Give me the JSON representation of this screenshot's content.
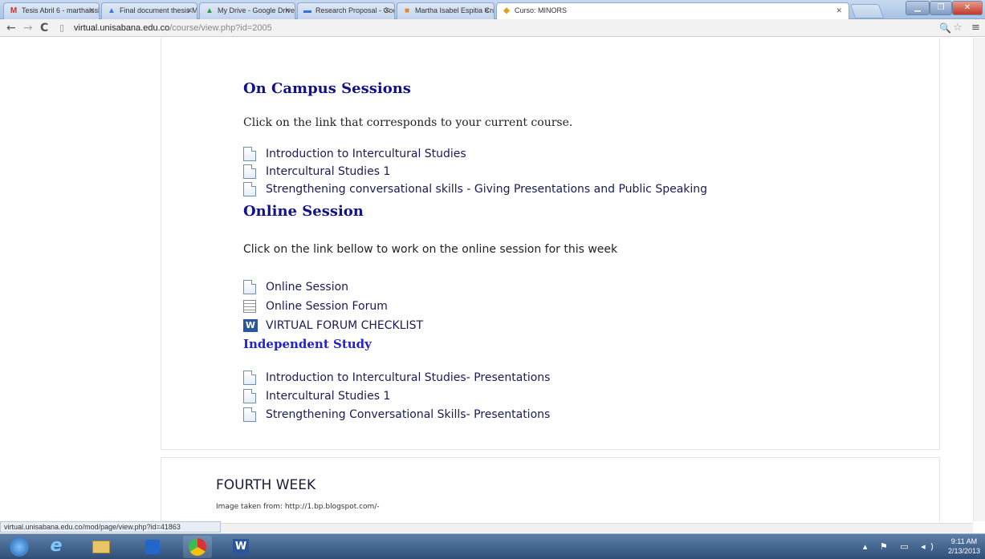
{
  "tabs": [
    {
      "label": "Tesis Abril 6 - marthaissb",
      "icon": "gmail-icon",
      "icon_glyph": "M",
      "icon_color": "#c8332b"
    },
    {
      "label": "Final document thesis Ma",
      "icon": "drive-doc-icon",
      "icon_glyph": "▲",
      "icon_color": "#3a7bd5"
    },
    {
      "label": "My Drive - Google Drive",
      "icon": "google-drive-icon",
      "icon_glyph": "▲",
      "icon_color": "#2e9c4a"
    },
    {
      "label": "Research Proposal - Goog",
      "icon": "google-slides-icon",
      "icon_glyph": "▬",
      "icon_color": "#3a6fd8"
    },
    {
      "label": "Martha Isabel Espitia Cruz",
      "icon": "office-icon",
      "icon_glyph": "■",
      "icon_color": "#e08a1e"
    },
    {
      "label": "Curso: MINORS",
      "icon": "moodle-icon",
      "icon_glyph": "◆",
      "icon_color": "#e0a020"
    }
  ],
  "address": {
    "domain": "virtual.unisabana.edu.co",
    "path": "/course/view.php?id=2005"
  },
  "on_campus": {
    "heading": "On Campus Sessions",
    "instruction": "Click on the link that corresponds to your current course.",
    "links": [
      "Introduction to Intercultural Studies",
      "Intercultural Studies 1",
      "Strengthening conversational skills - Giving Presentations and Public Speaking"
    ]
  },
  "online": {
    "heading": "Online Session",
    "instruction": "Click on the link bellow to work on the online session for this week",
    "links": [
      "Online Session",
      "Online Session Forum",
      "VIRTUAL FORUM CHECKLIST"
    ]
  },
  "independent": {
    "heading": "Independent Study",
    "links": [
      "Introduction to Intercultural Studies- Presentations",
      "Intercultural Studies 1",
      "Strengthening Conversational Skills- Presentations"
    ]
  },
  "fourth_week": {
    "heading": "FOURTH WEEK",
    "caption": "Image taken from: http://1.bp.blogspot.com/-"
  },
  "status_url": "virtual.unisabana.edu.co/mod/page/view.php?id=41863",
  "clock": {
    "time": "9:11 AM",
    "date": "2/13/2013"
  },
  "colors": {
    "heading": "#12128a",
    "independent_heading": "#2323c8"
  }
}
